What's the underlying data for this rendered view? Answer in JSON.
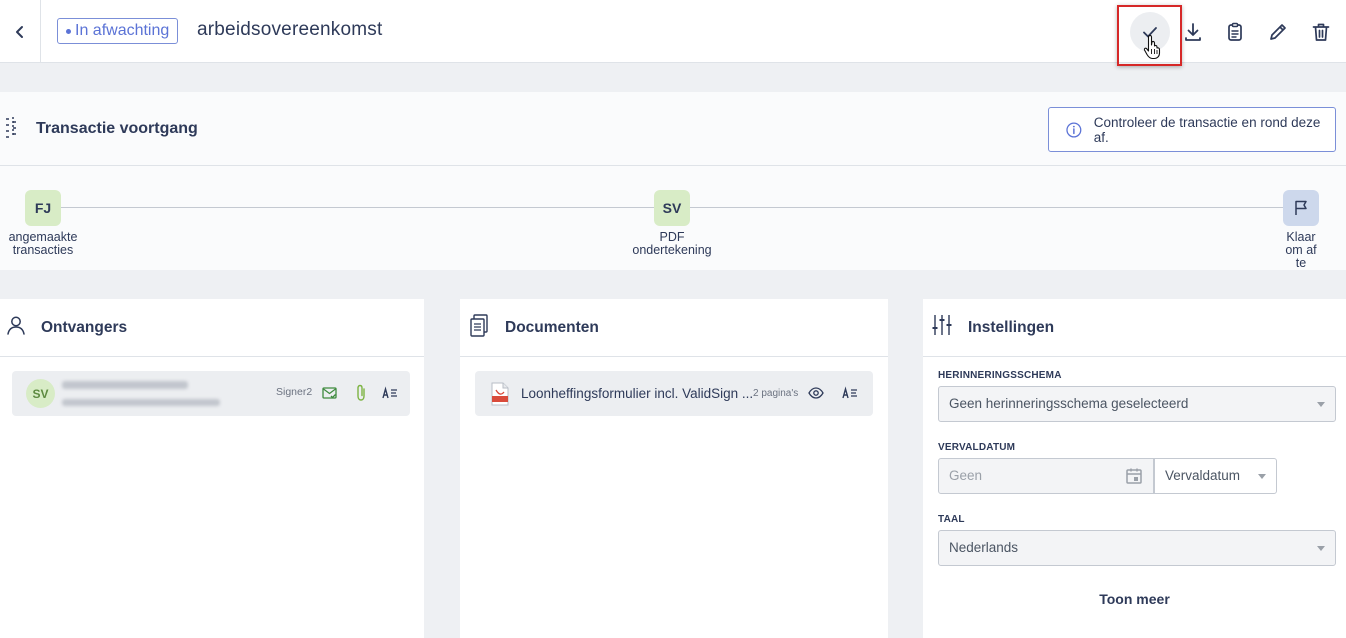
{
  "header": {
    "status": "In afwachting",
    "title": "arbeidsovereenkomst"
  },
  "progress": {
    "title": "Transactie voortgang",
    "info": "Controleer de transactie en rond deze af.",
    "steps": [
      {
        "initials": "FJ",
        "label_1": "angemaakte",
        "label_2": "transacties"
      },
      {
        "initials": "SV",
        "label_1": "PDF",
        "label_2": "ondertekening"
      },
      {
        "initials": "",
        "label_1": "Klaar",
        "label_2": "om af",
        "label_3": "te"
      }
    ]
  },
  "recipients": {
    "title": "Ontvangers",
    "items": [
      {
        "initials": "SV",
        "role": "Signer2"
      }
    ]
  },
  "documents": {
    "title": "Documenten",
    "items": [
      {
        "name": "Loonheffingsformulier incl. ValidSign ...",
        "pages": "2 pagina's"
      }
    ]
  },
  "settings": {
    "title": "Instellingen",
    "reminder_label": "HERINNERINGSSCHEMA",
    "reminder_value": "Geen herinneringsschema geselecteerd",
    "expiry_label": "VERVALDATUM",
    "expiry_value": "Geen",
    "expiry_type": "Vervaldatum",
    "language_label": "TAAL",
    "language_value": "Nederlands",
    "more": "Toon meer"
  },
  "colors": {
    "accent": "#5b73d6",
    "highlight": "#d62828",
    "step_green": "#d8ecc6",
    "step_blue": "#cdd8ec"
  }
}
